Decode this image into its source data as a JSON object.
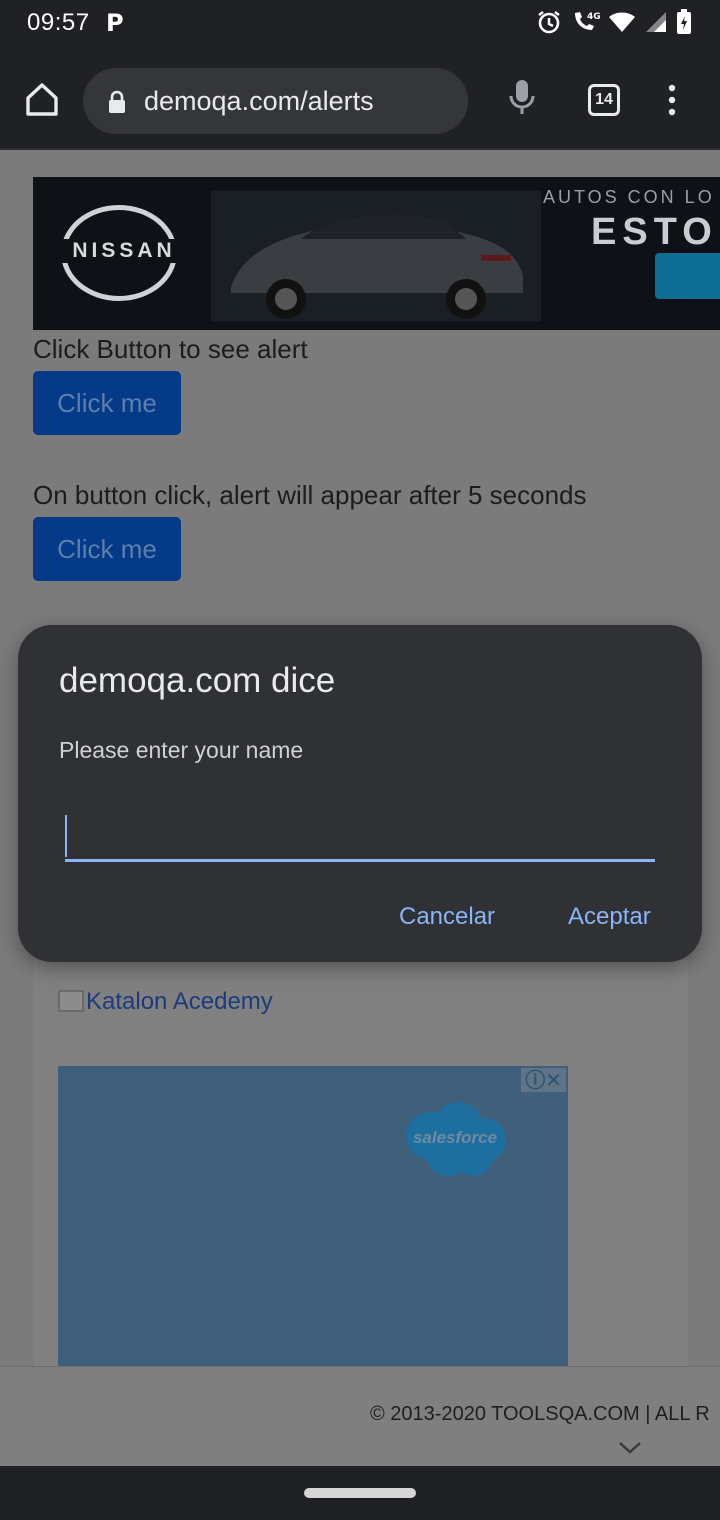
{
  "status_bar": {
    "time": "09:57",
    "parking_glyph": "P",
    "network": "4G",
    "icons": [
      "alarm-icon",
      "wifi-call-icon",
      "wifi-icon",
      "signal-icon",
      "battery-charging-icon"
    ]
  },
  "browser": {
    "url": "demoqa.com/alerts",
    "tab_count": "14",
    "icons": [
      "home-icon",
      "lock-icon",
      "mic-icon",
      "tabs-icon",
      "menu-icon"
    ]
  },
  "page": {
    "ad_banner": {
      "brand": "NISSAN",
      "headline": "AUTOS CON LO",
      "subheadline": "ESTO"
    },
    "alert1": {
      "label": "Click Button to see alert",
      "button": "Click me"
    },
    "alert2": {
      "label": "On button click, alert will appear after 5 seconds",
      "button": "Click me"
    },
    "katalon_link": "Katalon Acedemy",
    "salesforce_ad": {
      "brand": "salesforce",
      "info_glyph": "ⓘ✕"
    },
    "footer": "© 2013-2020 TOOLSQA.COM | ALL R"
  },
  "dialog": {
    "title": "demoqa.com dice",
    "message": "Please enter your name",
    "input_value": "",
    "cancel_label": "Cancelar",
    "accept_label": "Aceptar"
  },
  "colors": {
    "accent": "#8ab4f8",
    "dialog_bg": "#303134",
    "toolbar_bg": "#202124",
    "button_bg": "#053a88"
  }
}
